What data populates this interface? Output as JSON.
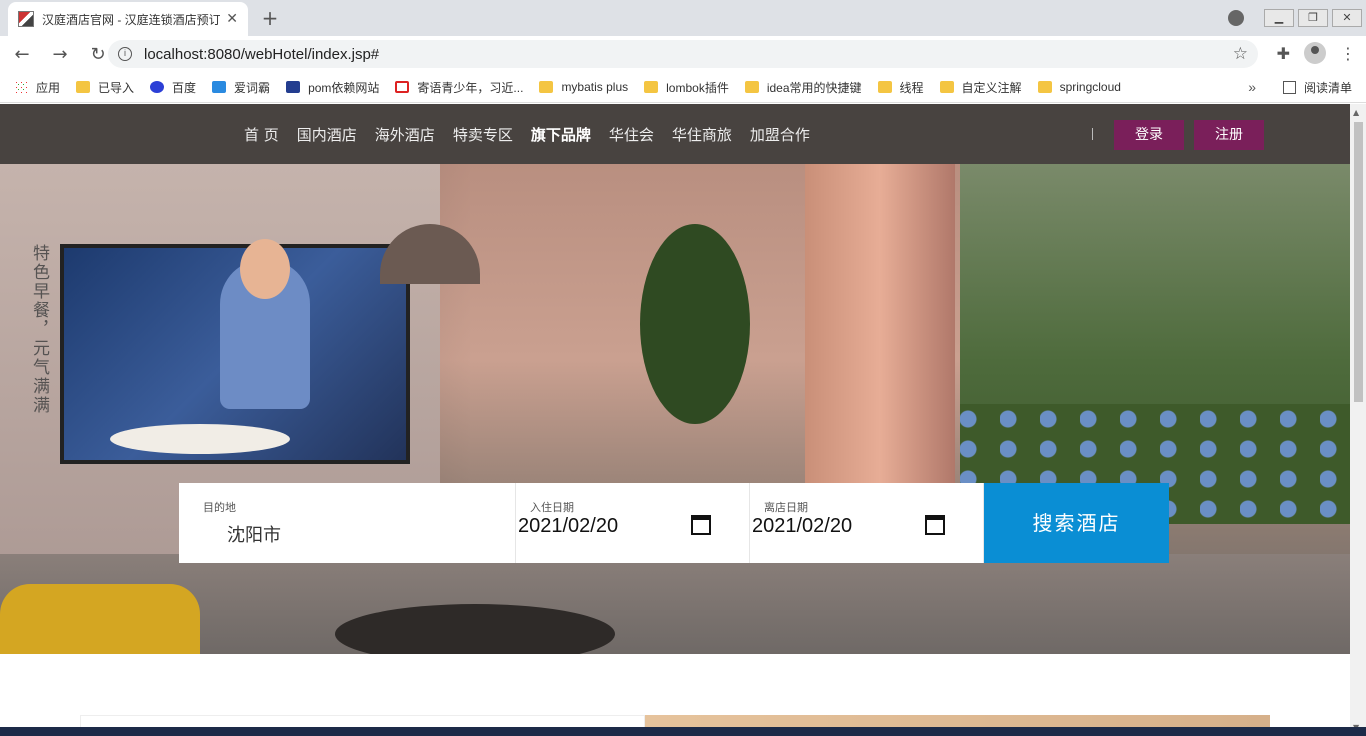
{
  "browser": {
    "tab_title": "汉庭酒店官网 - 汉庭连锁酒店预订",
    "tab_close": "✕",
    "new_tab": "+",
    "url": "localhost:8080/webHotel/index.jsp#",
    "bookmarks": [
      {
        "label": "应用",
        "icon": "apps"
      },
      {
        "label": "已导入",
        "icon": "folder"
      },
      {
        "label": "百度",
        "icon": "baidu"
      },
      {
        "label": "爱词霸",
        "icon": "aici"
      },
      {
        "label": "pom依赖网站",
        "icon": "mvn"
      },
      {
        "label": "寄语青少年，习近...",
        "icon": "jiyu"
      },
      {
        "label": "mybatis plus",
        "icon": "folder"
      },
      {
        "label": "lombok插件",
        "icon": "folder"
      },
      {
        "label": "idea常用的快捷键",
        "icon": "folder"
      },
      {
        "label": "线程",
        "icon": "folder"
      },
      {
        "label": "自定义注解",
        "icon": "folder"
      },
      {
        "label": "springcloud",
        "icon": "folder"
      }
    ],
    "bookmarks_more": "»",
    "reading_list": "阅读清单"
  },
  "nav": {
    "links": [
      "首 页",
      "国内酒店",
      "海外酒店",
      "特卖专区",
      "旗下品牌",
      "华住会",
      "华住商旅",
      "加盟合作"
    ],
    "active_index": 4,
    "login": "登录",
    "register": "注册"
  },
  "hero": {
    "vertical_text": "特色早餐，元气满满"
  },
  "search": {
    "destination_label": "目的地",
    "destination_value": "沈阳市",
    "checkin_label": "入住日期",
    "checkin_value": "2021/02/20",
    "checkout_label": "离店日期",
    "checkout_value": "2021/02/20",
    "button": "搜索酒店"
  },
  "colors": {
    "nav_bg": "#484340",
    "auth_button": "#7a1f5a",
    "search_button": "#0a8ed4"
  }
}
